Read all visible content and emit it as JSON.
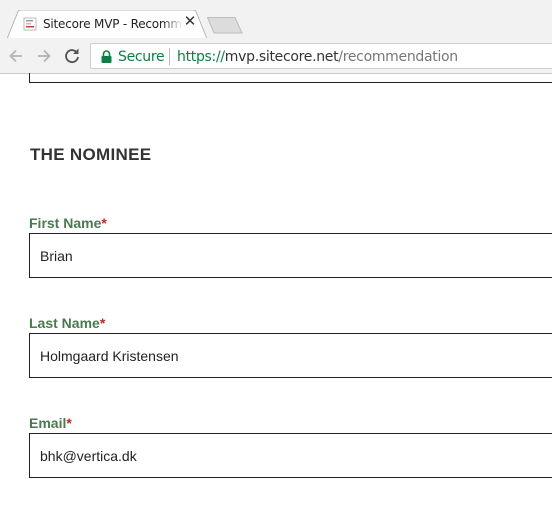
{
  "browser": {
    "tab_title": "Sitecore MVP - Recommendation",
    "tab_close_icon": "close-icon",
    "security_label": "Secure",
    "url_scheme": "https://",
    "url_host": "mvp.sitecore.net",
    "url_path": "/recommendation"
  },
  "form": {
    "section_title": "THE NOMINEE",
    "required_marker": "*",
    "first_name": {
      "label": "First Name",
      "value": "Brian"
    },
    "last_name": {
      "label": "Last Name",
      "value": "Holmgaard Kristensen"
    },
    "email": {
      "label": "Email",
      "value": "bhk@vertica.dk"
    }
  },
  "colors": {
    "label_green": "#4a7a4f",
    "required_red": "#c0262b",
    "secure_green": "#0b8043"
  }
}
